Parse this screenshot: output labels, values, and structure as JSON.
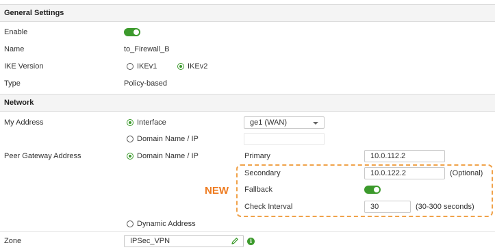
{
  "sections": {
    "general": "General Settings",
    "network": "Network"
  },
  "general": {
    "enable_label": "Enable",
    "enable_on": true,
    "name_label": "Name",
    "name_value": "to_Firewall_B",
    "ike_label": "IKE Version",
    "ike_options": [
      "IKEv1",
      "IKEv2"
    ],
    "ike_selected": "IKEv2",
    "type_label": "Type",
    "type_value": "Policy-based"
  },
  "network": {
    "my_address_label": "My Address",
    "my_address_options": [
      "Interface",
      "Domain Name / IP"
    ],
    "my_address_selected": "Interface",
    "interface_value": "ge1 (WAN)",
    "domain_value": "",
    "peer_label": "Peer Gateway Address",
    "peer_options": [
      "Domain Name / IP",
      "Dynamic Address"
    ],
    "peer_selected": "Domain Name / IP",
    "primary_label": "Primary",
    "primary_value": "10.0.112.2",
    "secondary_label": "Secondary",
    "secondary_value": "10.0.122.2",
    "secondary_hint": "(Optional)",
    "fallback_label": "Fallback",
    "fallback_on": true,
    "check_interval_label": "Check Interval",
    "check_interval_value": "30",
    "check_interval_hint": "(30-300 seconds)",
    "new_tag": "NEW",
    "zone_label": "Zone",
    "zone_value": "IPSec_VPN"
  },
  "icons": {
    "edit": "pencil-icon",
    "info": "info-icon"
  },
  "colors": {
    "accent_green": "#3c9a2c",
    "highlight_orange": "#f0a24a",
    "new_orange": "#ee7a1e"
  }
}
